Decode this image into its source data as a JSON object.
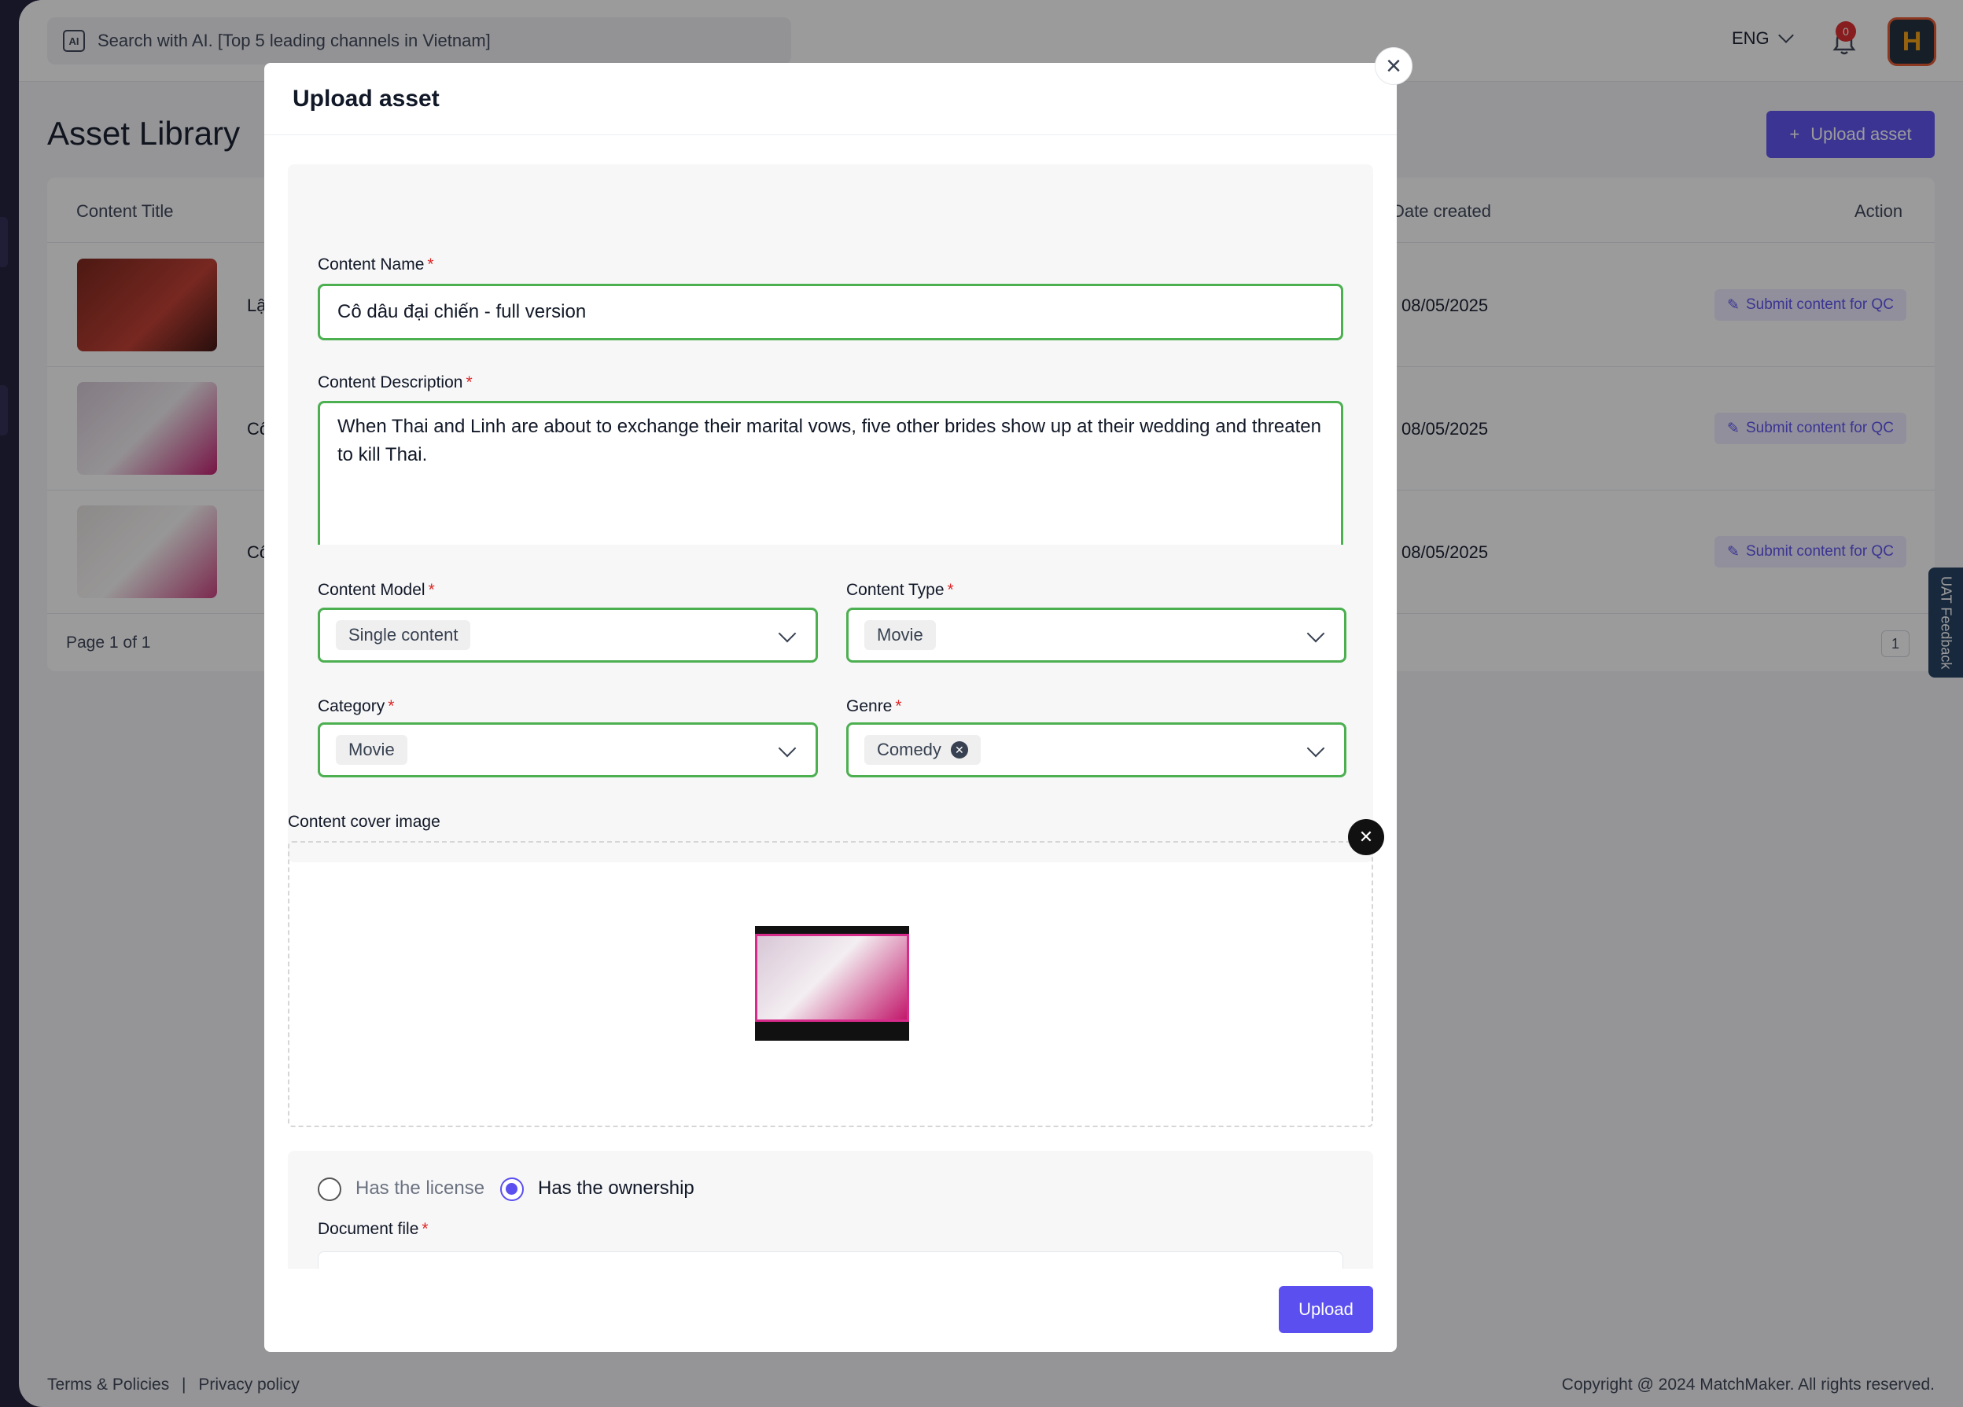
{
  "header": {
    "search_text": "Search with AI. [Top 5 leading channels in Vietnam]",
    "ai_icon_text": "AI",
    "language": "ENG",
    "notification_count": "0",
    "avatar_letter": "H"
  },
  "page": {
    "title": "Asset Library",
    "upload_button": "Upload asset",
    "columns": {
      "content_title": "Content Title",
      "date_created": "Date created",
      "action": "Action"
    },
    "rows": [
      {
        "title": "Lậ",
        "date": "08/05/2025",
        "action": "Submit content for QC"
      },
      {
        "title": "Cô",
        "date": "08/05/2025",
        "action": "Submit content for QC"
      },
      {
        "title": "Cô",
        "date": "08/05/2025",
        "action": "Submit content for QC"
      }
    ],
    "pagination": "Page 1 of 1",
    "page_number": "1",
    "uat_feedback": "UAT Feedback"
  },
  "footer": {
    "terms": "Terms & Policies",
    "separator": "|",
    "privacy": "Privacy policy",
    "copyright": "Copyright @ 2024 MatchMaker. All rights reserved."
  },
  "modal": {
    "title": "Upload asset",
    "close_glyph": "×",
    "required_mark": "*",
    "content_name": {
      "label": "Content Name",
      "value": "Cô dâu đại chiến - full version"
    },
    "content_description": {
      "label": "Content Description",
      "value": "When Thai and Linh are about to exchange their marital vows, five other brides show up at their wedding and threaten to kill Thai."
    },
    "content_model": {
      "label": "Content Model",
      "value": "Single content"
    },
    "content_type": {
      "label": "Content Type",
      "value": "Movie"
    },
    "category": {
      "label": "Category",
      "value": "Movie"
    },
    "genre": {
      "label": "Genre",
      "value": "Comedy"
    },
    "cover_image": {
      "label": "Content cover image"
    },
    "rights": {
      "license_label": "Has the license",
      "ownership_label": "Has the ownership",
      "selected": "ownership"
    },
    "document_file": {
      "label": "Document file"
    },
    "upload_button": "Upload"
  },
  "colors": {
    "accent": "#5b4ff0",
    "valid_border": "#4caf50",
    "required": "#dc2626"
  }
}
